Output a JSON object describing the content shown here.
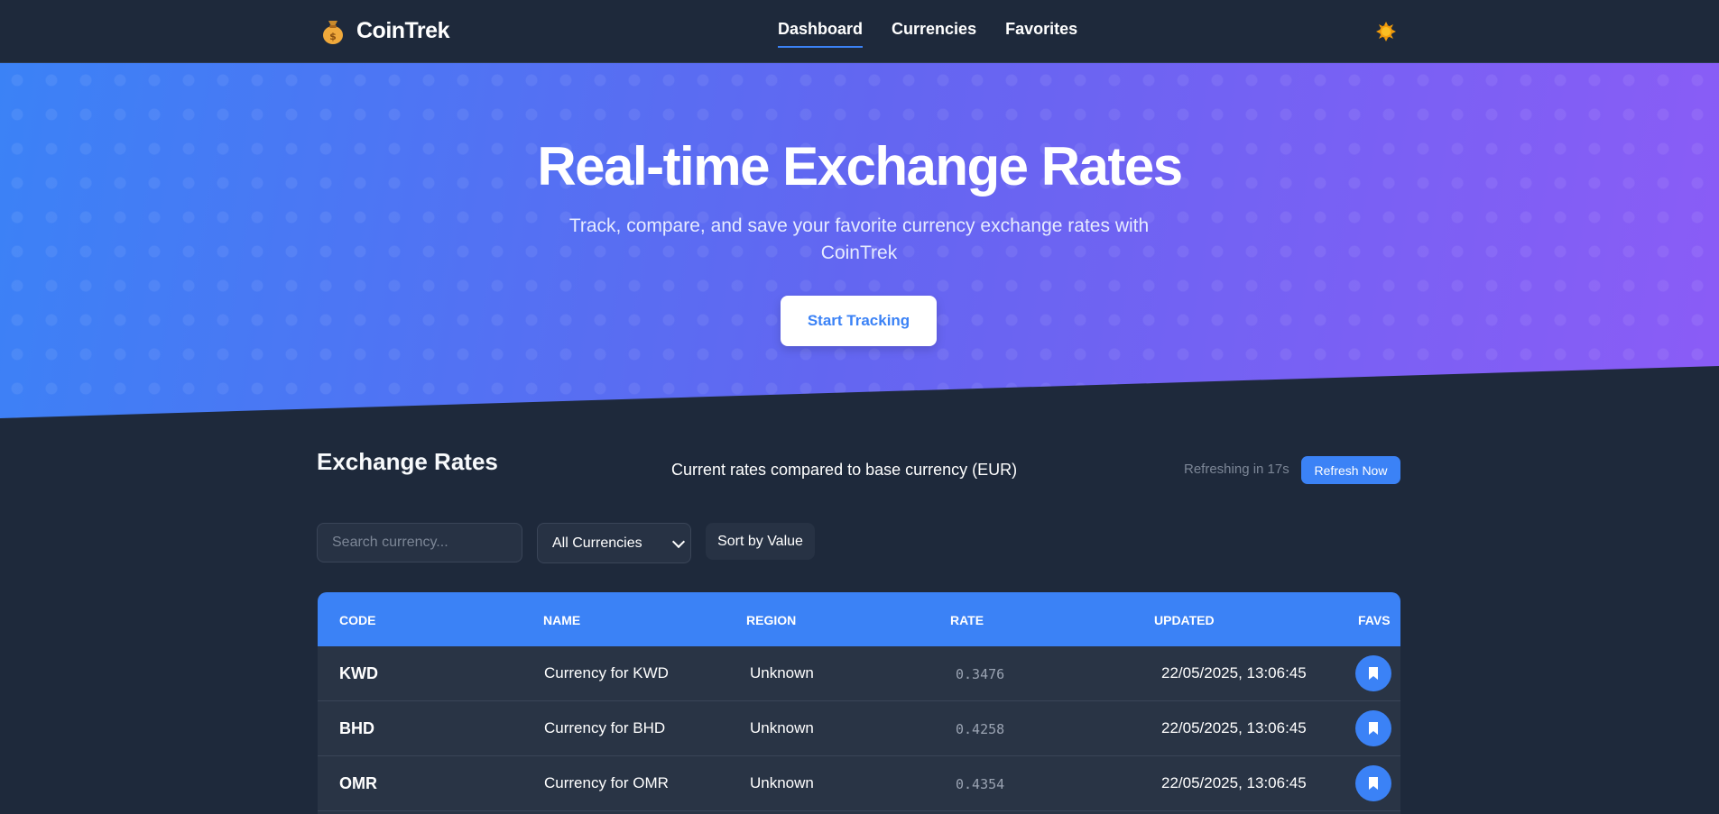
{
  "brand": {
    "name": "CoinTrek",
    "icon": "money-bag-icon"
  },
  "nav": {
    "items": [
      {
        "label": "Dashboard",
        "active": true
      },
      {
        "label": "Currencies",
        "active": false
      },
      {
        "label": "Favorites",
        "active": false
      }
    ],
    "theme_icon": "sun-icon"
  },
  "hero": {
    "title": "Real-time Exchange Rates",
    "subtitle": "Track, compare, and save your favorite currency exchange rates with CoinTrek",
    "cta_label": "Start Tracking"
  },
  "rates_section": {
    "title": "Exchange Rates",
    "subtitle": "Current rates compared to base currency (EUR)",
    "refresh_status": "Refreshing in 17s",
    "refresh_label": "Refresh Now"
  },
  "controls": {
    "search_placeholder": "Search currency...",
    "filter_selected": "All Currencies",
    "sort_label": "Sort by Value"
  },
  "table": {
    "columns": [
      "CODE",
      "NAME",
      "REGION",
      "RATE",
      "UPDATED",
      "FAVS"
    ],
    "rows": [
      {
        "code": "KWD",
        "name": "Currency for KWD",
        "region": "Unknown",
        "rate": "0.3476",
        "updated": "22/05/2025, 13:06:45"
      },
      {
        "code": "BHD",
        "name": "Currency for BHD",
        "region": "Unknown",
        "rate": "0.4258",
        "updated": "22/05/2025, 13:06:45"
      },
      {
        "code": "OMR",
        "name": "Currency for OMR",
        "region": "Unknown",
        "rate": "0.4354",
        "updated": "22/05/2025, 13:06:45"
      }
    ],
    "fav_icon": "bookmark-icon"
  },
  "colors": {
    "background": "#1e293b",
    "accent": "#3b82f6",
    "hero_gradient": [
      "#3b82f6",
      "#8b5cf6"
    ]
  }
}
